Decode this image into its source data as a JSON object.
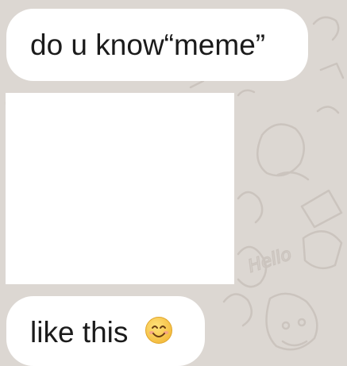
{
  "chat": {
    "messages": [
      {
        "type": "text",
        "text": "do u know“meme”"
      },
      {
        "type": "image"
      },
      {
        "type": "text",
        "text": "like this",
        "emoji": "smiling-face-emoji"
      }
    ]
  },
  "colors": {
    "wallpaper": "#dcd7d2",
    "bubble": "#ffffff",
    "text": "#1b1b1b",
    "emoji_face": "#f7c84a"
  },
  "wallpaper_doodle_text": "Hello"
}
